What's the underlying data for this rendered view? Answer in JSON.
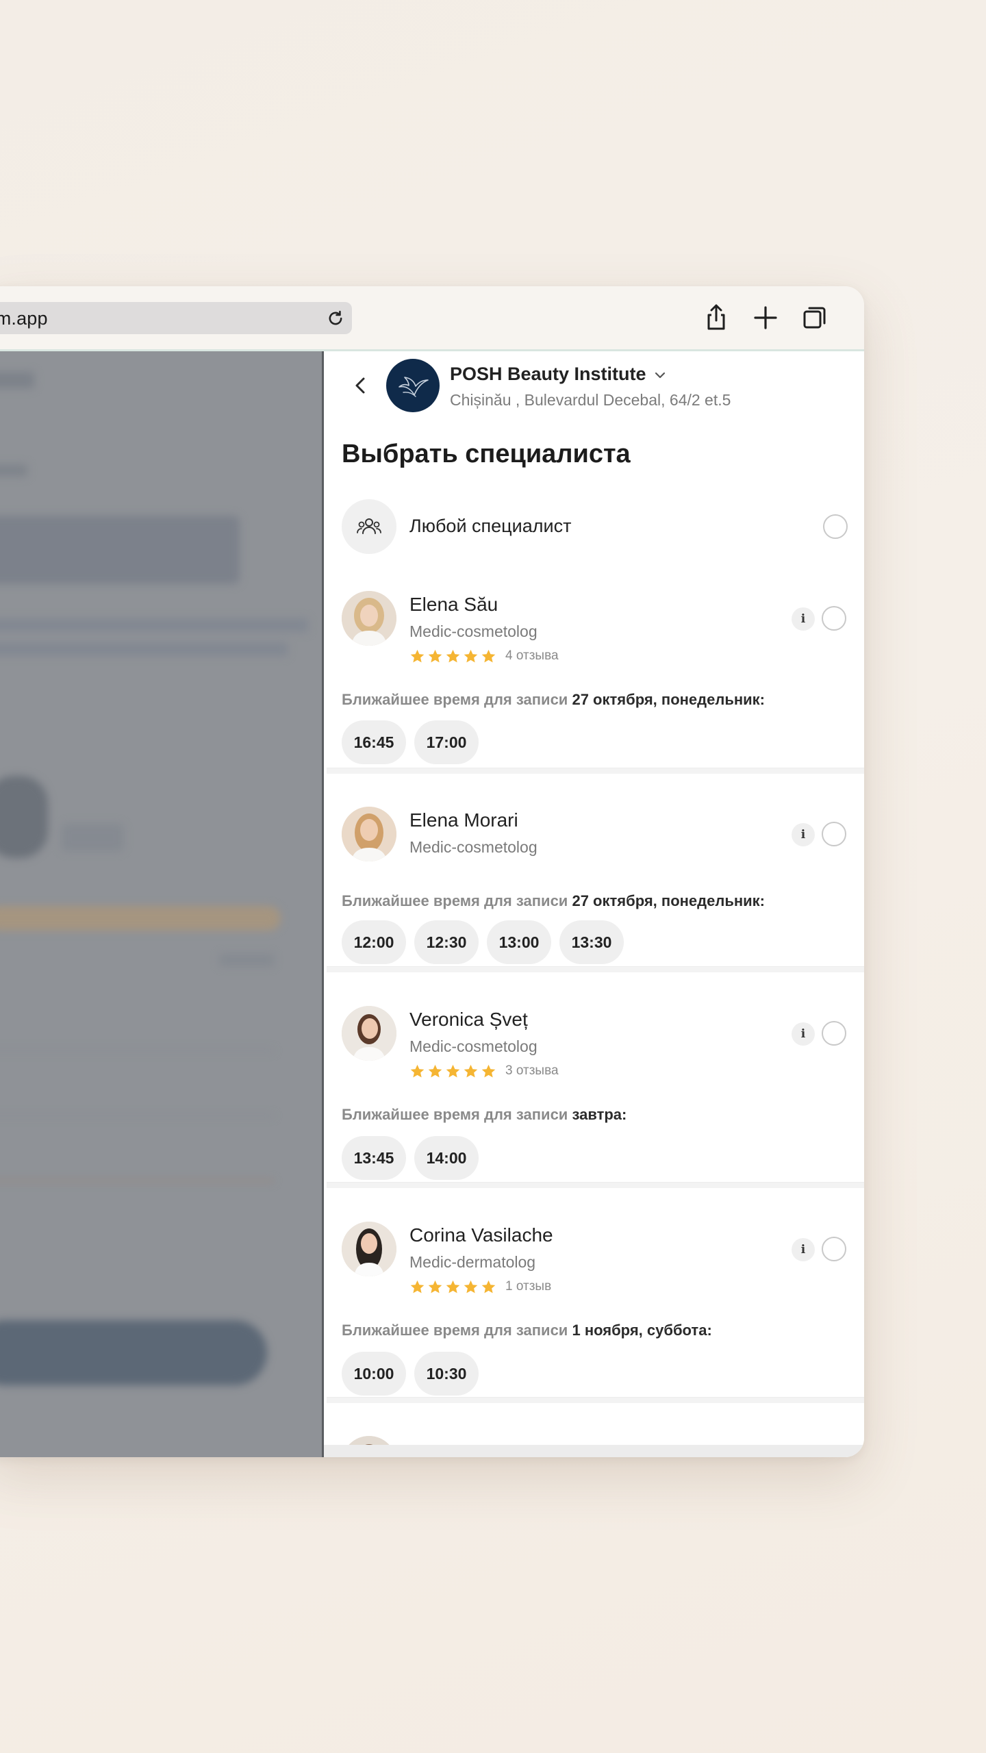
{
  "browser": {
    "url": "ym.app",
    "icons": [
      "reload-icon",
      "share-icon",
      "plus-icon",
      "tabs-icon"
    ]
  },
  "header": {
    "salon_name": "POSH Beauty Institute",
    "salon_address": "Chișinău , Bulevardul Decebal, 64/2 et.5"
  },
  "page_title": "Выбрать специалиста",
  "any_specialist": {
    "label": "Любой специалист"
  },
  "nearest_prefix": "Ближайшее время для записи",
  "specialists": [
    {
      "name": "Elena Său",
      "role": "Medic-cosmetolog",
      "rating": 5,
      "reviews": "4 отзыва",
      "nearest_date": "27 октября, понедельник:",
      "slots": [
        "16:45",
        "17:00"
      ]
    },
    {
      "name": "Elena Morari",
      "role": "Medic-cosmetolog",
      "nearest_date": "27 октября, понедельник:",
      "slots": [
        "12:00",
        "12:30",
        "13:00",
        "13:30"
      ]
    },
    {
      "name": "Veronica Șveț",
      "role": "Medic-cosmetolog",
      "rating": 5,
      "reviews": "3 отзыва",
      "nearest_date": "завтра:",
      "slots": [
        "13:45",
        "14:00"
      ]
    },
    {
      "name": "Corina Vasilache",
      "role": "Medic-dermatolog",
      "rating": 5,
      "reviews": "1 отзыв",
      "nearest_date": "1 ноября, суббота:",
      "slots": [
        "10:00",
        "10:30"
      ]
    }
  ],
  "colors": {
    "star": "#f5b533",
    "logo_bg": "#0f2a4a",
    "overlay": "#8f9297"
  }
}
